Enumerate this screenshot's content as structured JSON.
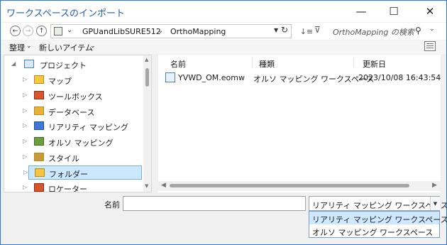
{
  "window": {
    "title": "ワークスペースのインポート"
  },
  "title_buttons": {
    "minimize": "—",
    "maximize": "☐",
    "close": "✕"
  },
  "address": {
    "crumbs": [
      "GPUandLibSURE512",
      "OrthoMapping"
    ],
    "search_placeholder": "OrthoMapping の検索"
  },
  "toolbar": {
    "organize": "整理",
    "new_item": "新しいアイテム"
  },
  "tree": {
    "root": "プロジェクト",
    "items": [
      {
        "label": "マップ",
        "icon": "map-icon",
        "color": "#f5c842"
      },
      {
        "label": "ツールボックス",
        "icon": "toolbox-icon",
        "color": "#d9532c"
      },
      {
        "label": "データベース",
        "icon": "database-icon",
        "color": "#e8b13b"
      },
      {
        "label": "リアリティ マッピング",
        "icon": "reality-mapping-icon",
        "color": "#3b78d8"
      },
      {
        "label": "オルソ マッピング",
        "icon": "ortho-mapping-icon",
        "color": "#6a9e3f"
      },
      {
        "label": "スタイル",
        "icon": "style-icon",
        "color": "#c79a3a"
      },
      {
        "label": "フォルダー",
        "icon": "folder-icon",
        "color": "#f6c544"
      },
      {
        "label": "ロケーター",
        "icon": "locator-icon",
        "color": "#d9532c"
      }
    ],
    "selected_index": 6
  },
  "files": {
    "columns": [
      "名前",
      "種類",
      "更新日"
    ],
    "rows": [
      {
        "name": "YVWD_OM.eomw",
        "type": "オルソ マッピング ワークスペース",
        "modified": "2023/10/08 16:43:54"
      }
    ]
  },
  "footer": {
    "name_label": "名前",
    "name_value": "",
    "type_selected": "リアリティ マッピング ワークスペース",
    "type_options": [
      "リアリティ マッピング ワークスペース",
      "オルソ マッピング ワークスペース"
    ]
  },
  "colors": {
    "accent": "#2b79d8",
    "selection": "#cce8ff",
    "title_text": "#1e5bb8"
  }
}
